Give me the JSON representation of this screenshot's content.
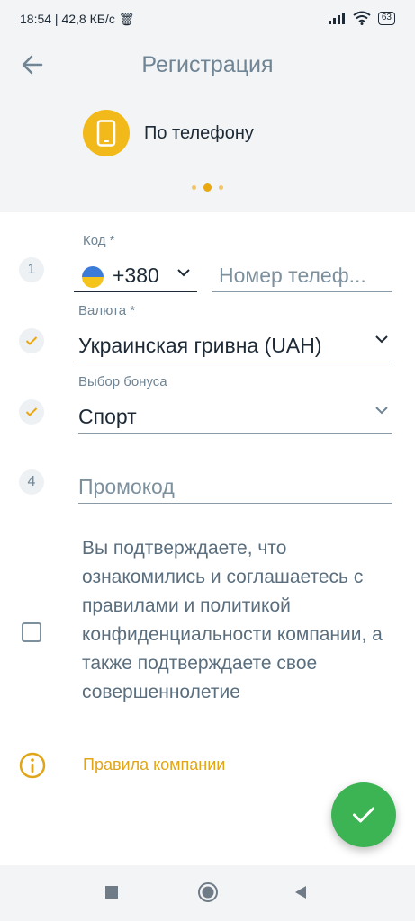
{
  "status_bar": {
    "left_text": "18:54 | 42,8 КБ/с 🗑",
    "battery": "63"
  },
  "header": {
    "title": "Регистрация",
    "method_label": "По телефону",
    "accent_color": "#f2b91b"
  },
  "form": {
    "code": {
      "step": "1",
      "label": "Код *",
      "country_code": "+380",
      "phone_placeholder": "Номер телеф..."
    },
    "currency": {
      "label": "Валюта *",
      "value": "Украинская гривна (UAH)"
    },
    "bonus": {
      "label": "Выбор бонуса",
      "value": "Спорт"
    },
    "promo": {
      "step": "4",
      "placeholder": "Промокод"
    },
    "consent_text": "Вы подтверждаете, что ознакомились и соглашаетесь с правилами и политикой конфиденциальности компании, а также подтверждаете свое совершеннолетие",
    "rules_link": "Правила компании"
  },
  "colors": {
    "fab": "#3db454",
    "link": "#e0a518"
  },
  "icons": [
    "back-arrow-icon",
    "phone-icon",
    "flag-ukraine-icon",
    "chevron-down-icon",
    "check-icon",
    "info-icon"
  ]
}
